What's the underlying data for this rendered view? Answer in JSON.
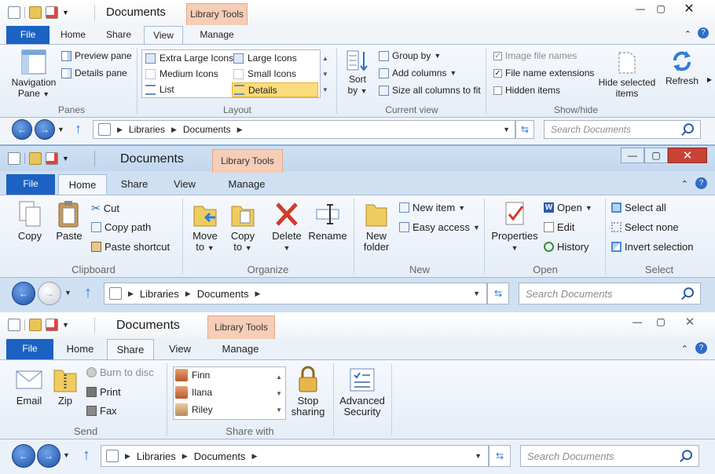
{
  "w1": {
    "title": "Documents",
    "context_tab": "Library Tools",
    "tabs": [
      "File",
      "Home",
      "Share",
      "View",
      "Manage"
    ],
    "groups": {
      "panes": {
        "label": "Panes",
        "nav_pane": "Navigation",
        "nav_pane2": "Pane",
        "preview": "Preview pane",
        "details": "Details pane"
      },
      "layout": {
        "label": "Layout",
        "items": [
          "Extra Large Icons",
          "Large Icons",
          "Medium Icons",
          "Small Icons",
          "List",
          "Details"
        ]
      },
      "current_view": {
        "label": "Current view",
        "sort": "Sort",
        "sort2": "by",
        "group_by": "Group by",
        "add_columns": "Add columns",
        "size_cols": "Size all columns to fit"
      },
      "show_hide": {
        "label": "Show/hide",
        "image_names": "Image file names",
        "file_ext": "File name extensions",
        "hidden": "Hidden items",
        "hide_selected": "Hide selected",
        "hide_selected2": "items"
      },
      "refresh": "Refresh"
    },
    "address": [
      "Libraries",
      "Documents"
    ],
    "search_placeholder": "Search Documents"
  },
  "w2": {
    "title": "Documents",
    "context_tab": "Library Tools",
    "tabs": [
      "File",
      "Home",
      "Share",
      "View",
      "Manage"
    ],
    "groups": {
      "clipboard": {
        "label": "Clipboard",
        "copy": "Copy",
        "paste": "Paste",
        "cut": "Cut",
        "copy_path": "Copy path",
        "paste_shortcut": "Paste shortcut"
      },
      "organize": {
        "label": "Organize",
        "move_to": "Move",
        "move_to2": "to",
        "copy_to": "Copy",
        "copy_to2": "to",
        "delete": "Delete",
        "rename": "Rename"
      },
      "new": {
        "label": "New",
        "new_folder": "New",
        "new_folder2": "folder",
        "new_item": "New item",
        "easy_access": "Easy access"
      },
      "open": {
        "label": "Open",
        "properties": "Properties",
        "open": "Open",
        "edit": "Edit",
        "history": "History"
      },
      "select": {
        "label": "Select",
        "select_all": "Select all",
        "select_none": "Select none",
        "invert": "Invert selection"
      }
    },
    "address": [
      "Libraries",
      "Documents"
    ],
    "search_placeholder": "Search Documents"
  },
  "w3": {
    "title": "Documents",
    "context_tab": "Library Tools",
    "tabs": [
      "File",
      "Home",
      "Share",
      "View",
      "Manage"
    ],
    "groups": {
      "send": {
        "label": "Send",
        "email": "Email",
        "zip": "Zip",
        "burn": "Burn to disc",
        "print": "Print",
        "fax": "Fax"
      },
      "share_with": {
        "label": "Share with",
        "people": [
          "Finn",
          "Ilana",
          "Riley"
        ],
        "stop": "Stop",
        "stop2": "sharing"
      },
      "security": {
        "adv": "Advanced",
        "adv2": "Security"
      }
    },
    "address": [
      "Libraries",
      "Documents"
    ],
    "search_placeholder": "Search Documents"
  },
  "colors": {
    "file_tab": "#1b62c3",
    "context": "#f6cdb6",
    "close_red": "#c94235",
    "selected_item": "#fbdb7a"
  }
}
